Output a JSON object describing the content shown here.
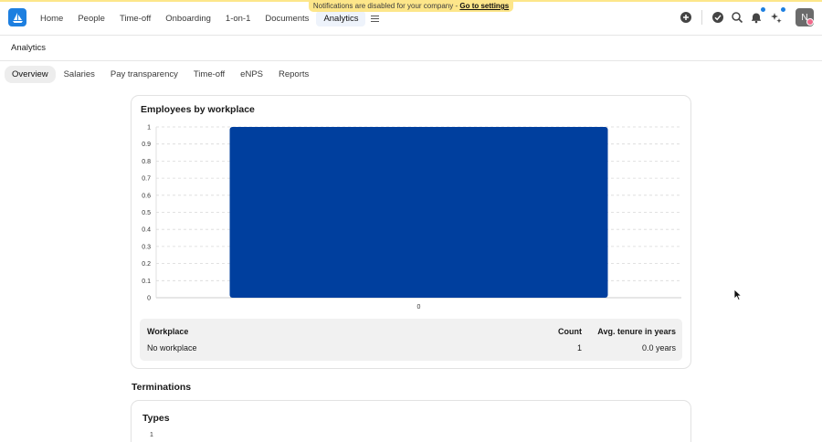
{
  "banner": {
    "text": "Notifications are disabled for your company -",
    "link": "Go to settings"
  },
  "logo": {
    "name": "app-logo"
  },
  "nav": {
    "items": [
      {
        "label": "Home"
      },
      {
        "label": "People"
      },
      {
        "label": "Time-off"
      },
      {
        "label": "Onboarding"
      },
      {
        "label": "1-on-1"
      },
      {
        "label": "Documents"
      },
      {
        "label": "Analytics"
      }
    ],
    "active": "Analytics",
    "menu_icon": "hamburger-icon"
  },
  "toolbar_icons": [
    "add-circle-icon",
    "check-circle-icon",
    "search-icon",
    "bell-icon",
    "sparkle-icon"
  ],
  "avatar": {
    "initial": "N"
  },
  "page": {
    "title": "Analytics"
  },
  "tabs": [
    {
      "label": "Overview"
    },
    {
      "label": "Salaries"
    },
    {
      "label": "Pay transparency"
    },
    {
      "label": "Time-off"
    },
    {
      "label": "eNPS"
    },
    {
      "label": "Reports"
    }
  ],
  "workplace_card": {
    "title": "Employees by workplace",
    "table": {
      "headers": {
        "workplace": "Workplace",
        "count": "Count",
        "tenure": "Avg. tenure in years"
      },
      "rows": [
        {
          "workplace": "No workplace",
          "count": "1",
          "tenure": "0.0 years"
        }
      ]
    }
  },
  "terminations": {
    "title": "Terminations",
    "types_title": "Types",
    "partial_tick": "1"
  },
  "colors": {
    "bar": "#003f9e",
    "accent": "#1d7fe0",
    "banner": "#fde68a"
  },
  "chart_data": {
    "type": "bar",
    "categories": [
      "0"
    ],
    "values": [
      1
    ],
    "ylim": [
      0,
      1
    ],
    "yticks": [
      "0",
      "0.1",
      "0.2",
      "0.3",
      "0.4",
      "0.5",
      "0.6",
      "0.7",
      "0.8",
      "0.9",
      "1"
    ],
    "grid": true
  }
}
